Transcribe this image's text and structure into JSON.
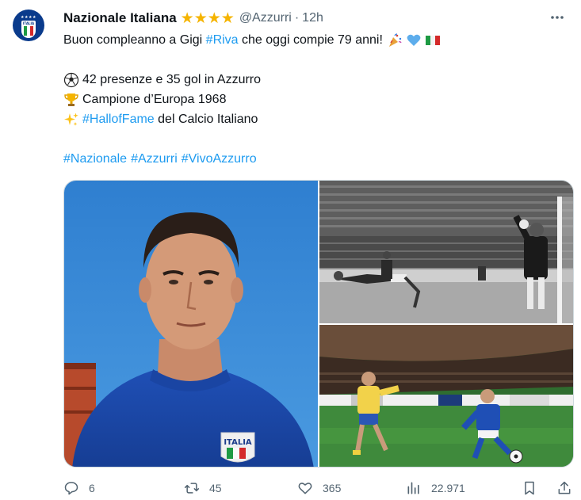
{
  "author": {
    "name": "Nazionale Italiana",
    "verified_stars": "★★★★",
    "handle": "@Azzurri",
    "separator": "·",
    "time": "12h",
    "avatar_text": "ITALIA"
  },
  "tweet": {
    "line1_prefix": "Buon compleanno a Gigi ",
    "line1_tag": "#Riva",
    "line1_suffix": " che oggi compie 79 anni!",
    "line2": "42 presenze e 35 gol in Azzurro",
    "line3": "Campione d’Europa 1968",
    "line4_tag": "#HallofFame",
    "line4_suffix": " del Calcio Italiano",
    "hashtags": [
      "#Nazionale",
      "#Azzurri",
      "#VivoAzzurro"
    ],
    "jersey_text": "ITALIA"
  },
  "actions": {
    "replies": "6",
    "reposts": "45",
    "likes": "365",
    "views": "22.971"
  },
  "colors": {
    "link": "#1d9bf0",
    "muted": "#536471",
    "gold": "#f5b400",
    "azzurro": "#1f4fb5"
  }
}
